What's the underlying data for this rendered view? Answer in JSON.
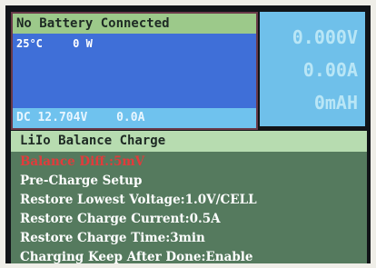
{
  "status_panel": {
    "title": "No Battery Connected",
    "temperature": "25°C",
    "power": "0 W",
    "dc_voltage": "DC 12.704V",
    "dc_current": "0.0A"
  },
  "readout": {
    "voltage": "0.000V",
    "current": "0.00A",
    "capacity": "0mAH"
  },
  "menu": {
    "mode_title": "LiIo Balance Charge",
    "items": [
      "Balance Diff.:5mV",
      "Pre-Charge Setup",
      "Restore Lowest Voltage:1.0V/CELL",
      "Restore Charge Current:0.5A",
      "Restore Charge Time:3min",
      "Charging Keep After Done:Enable"
    ]
  },
  "colors": {
    "title_bar": "#9cc98a",
    "body_area": "#3f6fd8",
    "readout_bg": "#6fc0ea",
    "menu_bg": "#557a5e",
    "warn_text": "#e23b3b"
  }
}
